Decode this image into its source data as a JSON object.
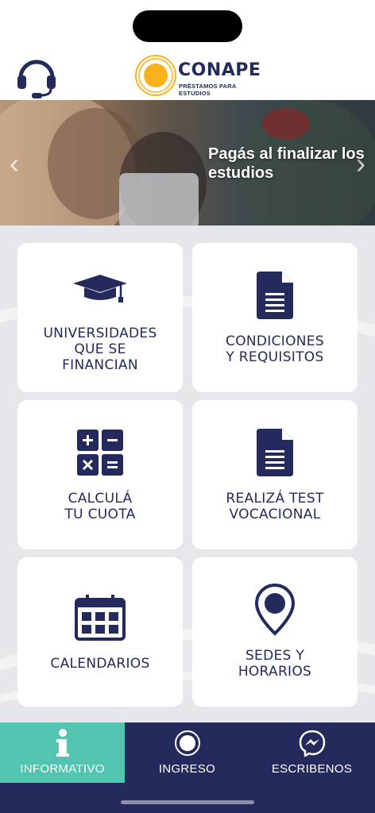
{
  "app": {
    "logo_name": "CONAPE",
    "logo_tagline": "PRÉSTAMOS PARA ESTUDIOS",
    "accent_color": "#252a5c",
    "active_tab_color": "#52c4b0"
  },
  "banner": {
    "text": "Pagás al finalizar los estudios"
  },
  "menu": [
    {
      "label": "UNIVERSIDADES\nQUE SE\nFINANCIAN",
      "icon": "graduation-cap-icon"
    },
    {
      "label": "CONDICIONES\nY REQUISITOS",
      "icon": "document-icon"
    },
    {
      "label": "CALCULÁ\nTU CUOTA",
      "icon": "calculator-icon"
    },
    {
      "label": "REALIZÁ TEST\nVOCACIONAL",
      "icon": "document-icon"
    },
    {
      "label": "CALENDARIOS",
      "icon": "calendar-icon"
    },
    {
      "label": "SEDES Y\nHORARIOS",
      "icon": "location-pin-icon"
    }
  ],
  "tabs": [
    {
      "label": "INFORMATIVO",
      "icon": "info-icon",
      "active": true
    },
    {
      "label": "INGRESO",
      "icon": "login-icon",
      "active": false
    },
    {
      "label": "ESCRIBENOS",
      "icon": "messenger-icon",
      "active": false
    }
  ]
}
